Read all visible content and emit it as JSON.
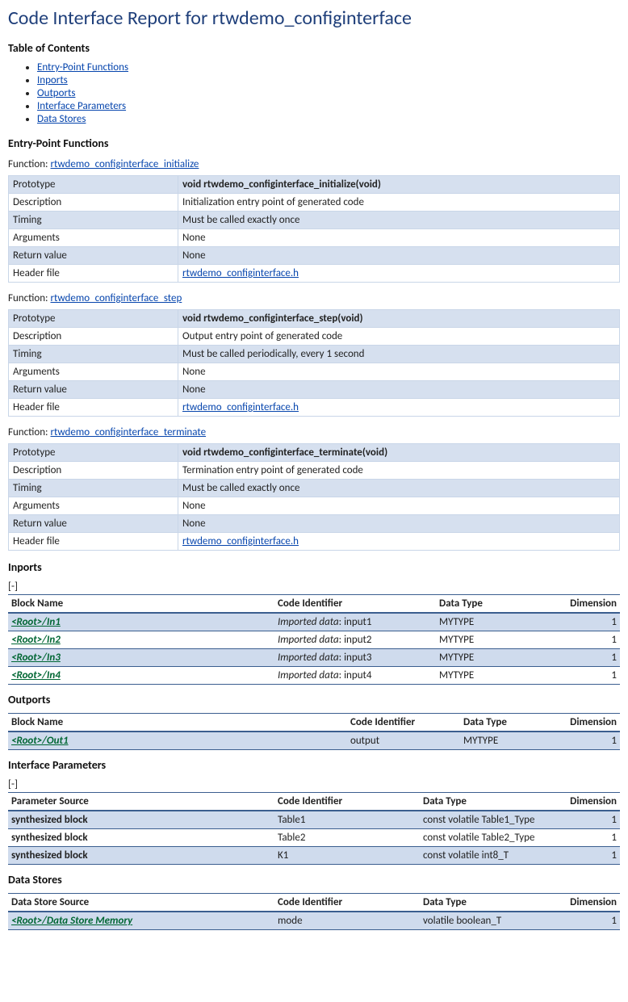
{
  "title": "Code Interface Report for rtwdemo_configinterface",
  "toc": {
    "heading": "Table of Contents",
    "items": [
      "Entry-Point Functions",
      "Inports",
      "Outports",
      "Interface Parameters",
      "Data Stores"
    ]
  },
  "entryPoints": {
    "heading": "Entry-Point Functions",
    "fnLabelPrefix": "Function: ",
    "headerLinkText": "rtwdemo_configinterface.h",
    "keys": {
      "prototype": "Prototype",
      "description": "Description",
      "timing": "Timing",
      "arguments": "Arguments",
      "return": "Return value",
      "header": "Header file"
    },
    "functions": [
      {
        "link": "rtwdemo_configinterface_initialize",
        "prototype": "void rtwdemo_configinterface_initialize(void)",
        "description": "Initialization entry point of generated code",
        "timing": "Must be called exactly once",
        "arguments": "None",
        "return": "None"
      },
      {
        "link": "rtwdemo_configinterface_step",
        "prototype": "void rtwdemo_configinterface_step(void)",
        "description": "Output entry point of generated code",
        "timing": "Must be called periodically, every 1 second",
        "arguments": "None",
        "return": "None"
      },
      {
        "link": "rtwdemo_configinterface_terminate",
        "prototype": "void rtwdemo_configinterface_terminate(void)",
        "description": "Termination entry point of generated code",
        "timing": "Must be called exactly once",
        "arguments": "None",
        "return": "None"
      }
    ]
  },
  "collapseLabel": "[-]",
  "importedDataPrefix": "Imported data",
  "cols": {
    "blockName": "Block Name",
    "paramSource": "Parameter Source",
    "dataStoreSource": "Data Store Source",
    "codeId": "Code Identifier",
    "dataType": "Data Type",
    "dimension": "Dimension"
  },
  "inports": {
    "heading": "Inports",
    "rows": [
      {
        "block": "<Root>/In1",
        "codeSuffix": "input1",
        "imported": true,
        "type": "MYTYPE",
        "dim": "1"
      },
      {
        "block": "<Root>/In2",
        "codeSuffix": "input2",
        "imported": true,
        "type": "MYTYPE",
        "dim": "1"
      },
      {
        "block": "<Root>/In3",
        "codeSuffix": "input3",
        "imported": true,
        "type": "MYTYPE",
        "dim": "1"
      },
      {
        "block": "<Root>/In4",
        "codeSuffix": "input4",
        "imported": true,
        "type": "MYTYPE",
        "dim": "1"
      }
    ]
  },
  "outports": {
    "heading": "Outports",
    "rows": [
      {
        "block": "<Root>/Out1",
        "code": "output",
        "type": "MYTYPE",
        "dim": "1"
      }
    ]
  },
  "params": {
    "heading": "Interface Parameters",
    "rows": [
      {
        "source": "synthesized block",
        "code": "Table1",
        "type": "const volatile Table1_Type",
        "dim": "1"
      },
      {
        "source": "synthesized block",
        "code": "Table2",
        "type": "const volatile Table2_Type",
        "dim": "1"
      },
      {
        "source": "synthesized block",
        "code": "K1",
        "type": "const volatile int8_T",
        "dim": "1"
      }
    ]
  },
  "dataStores": {
    "heading": "Data Stores",
    "rows": [
      {
        "source": "<Root>/Data Store Memory",
        "code": "mode",
        "type": "volatile boolean_T",
        "dim": "1"
      }
    ]
  }
}
